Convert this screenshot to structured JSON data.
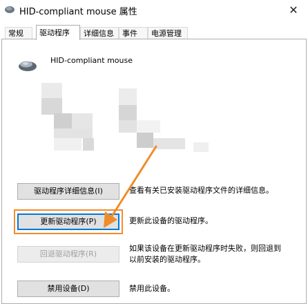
{
  "window": {
    "title": "HID-compliant mouse 属性",
    "close_glyph": "✕"
  },
  "tabs": [
    {
      "label": "常规"
    },
    {
      "label": "驱动程序"
    },
    {
      "label": "详细信息"
    },
    {
      "label": "事件"
    },
    {
      "label": "电源管理"
    }
  ],
  "device": {
    "name": "HID-compliant mouse",
    "icon": "mouse-icon"
  },
  "actions": [
    {
      "label": "驱动程序详细信息(I)",
      "description": "查看有关已安装驱动程序文件的详细信息。"
    },
    {
      "label": "更新驱动程序(P)",
      "description": "更新此设备的驱动程序。"
    },
    {
      "label": "回退驱动程序(R)",
      "description_line1": "如果该设备在更新驱动程序时失败，则回退到",
      "description_line2": "以前安装的驱动程序。"
    },
    {
      "label": "禁用设备(D)",
      "description": "禁用此设备。"
    }
  ],
  "colors": {
    "annotation": "#f08c2a",
    "focus": "#0078d7"
  }
}
